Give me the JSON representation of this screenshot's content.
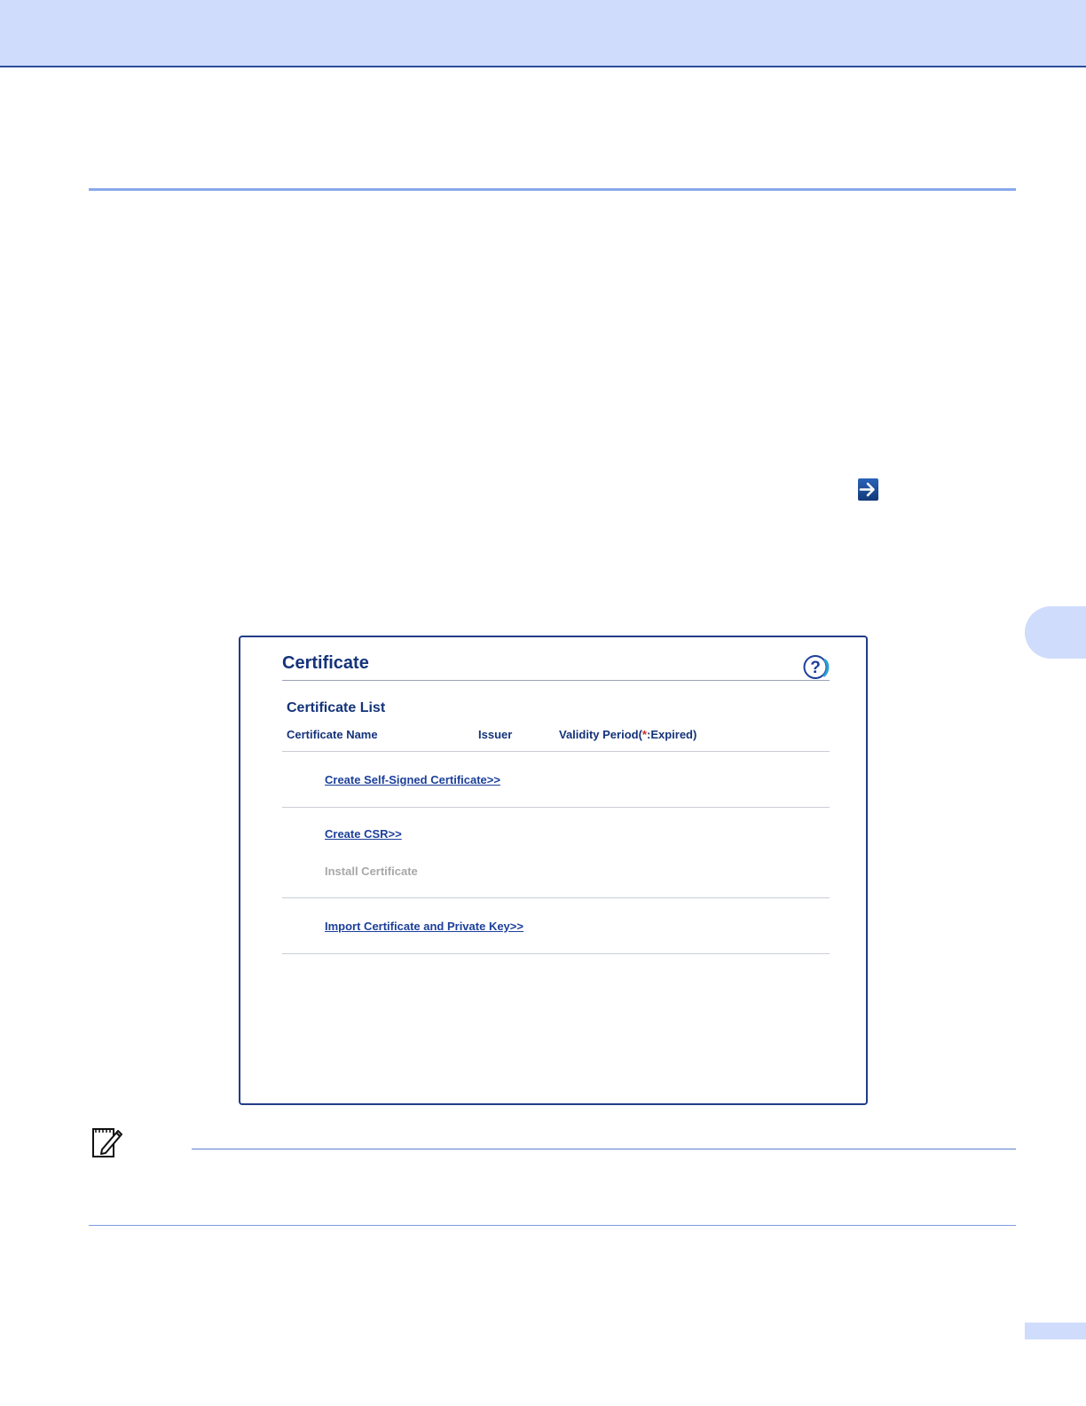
{
  "colors": {
    "header_band": "#cfdcfc",
    "header_border": "#2d4f9c",
    "link": "#1c3f9a",
    "heading": "#14337a",
    "disabled": "#a8a8a8",
    "expired_marker": "#d22a2a"
  },
  "icons": {
    "arrow": "right-arrow-icon",
    "help": "help-icon",
    "note": "note-pencil-icon"
  },
  "certificate_window": {
    "title": "Certificate",
    "list_heading": "Certificate List",
    "columns": {
      "name": "Certificate Name",
      "issuer": "Issuer",
      "validity_prefix": "Validity Period(",
      "validity_star": "*",
      "validity_suffix": ":Expired)"
    },
    "actions": {
      "create_self_signed": "Create Self-Signed Certificate>>",
      "create_csr": "Create CSR>>",
      "install_certificate": "Install Certificate",
      "import_key": "Import Certificate and Private Key>>"
    }
  }
}
